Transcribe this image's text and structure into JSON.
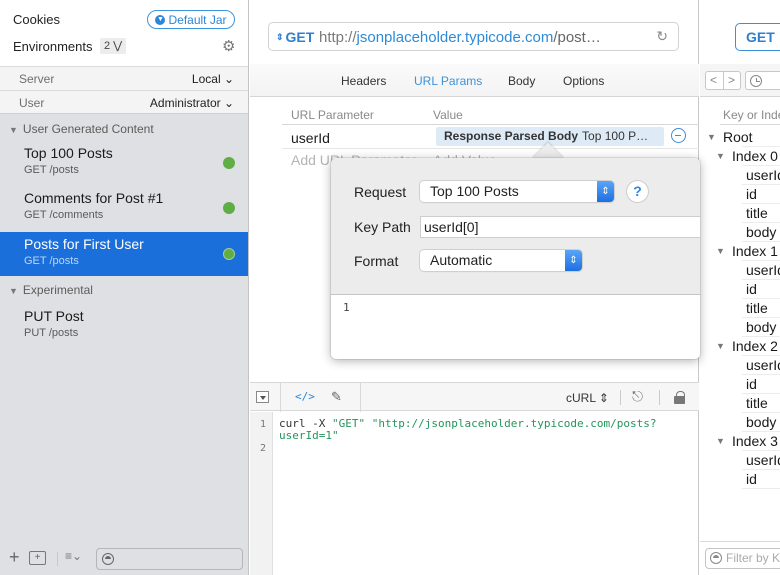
{
  "sidebar": {
    "cookies_label": "Cookies",
    "cookie_jar": "Default Jar",
    "environments_label": "Environments",
    "environments_count": "2",
    "env_vars": [
      {
        "key": "Server",
        "value": "Local"
      },
      {
        "key": "User",
        "value": "Administrator"
      }
    ],
    "groups": [
      {
        "name": "User Generated Content",
        "requests": [
          {
            "name": "Top 100 Posts",
            "sub": "GET /posts",
            "status": "success"
          },
          {
            "name": "Comments for Post #1",
            "sub": "GET /comments",
            "status": "success"
          },
          {
            "name": "Posts for First User",
            "sub": "GET /posts",
            "status": "success",
            "selected": true
          }
        ]
      },
      {
        "name": "Experimental",
        "requests": [
          {
            "name": "PUT Post",
            "sub": "PUT /posts"
          }
        ]
      }
    ],
    "filter_placeholder": ""
  },
  "request": {
    "method": "GET",
    "url_scheme": "http://",
    "url_host": "jsonplaceholder.typicode.com",
    "url_path": "/post…",
    "tabs": [
      "Headers",
      "URL Params",
      "Body",
      "Options"
    ],
    "active_tab": "URL Params",
    "params_header": {
      "name": "URL Parameter",
      "value": "Value"
    },
    "params": [
      {
        "name": "userId",
        "value_type": "Response Parsed Body",
        "value_ref": "Top 100 P…"
      }
    ],
    "add_param_placeholder": "Add URL Parameter",
    "add_value_placeholder": "Add Value"
  },
  "popover": {
    "request_label": "Request",
    "request_value": "Top 100 Posts",
    "help": "?",
    "keypath_label": "Key Path",
    "keypath_value": "userId[0]",
    "format_label": "Format",
    "format_value": "Automatic",
    "result_line": "1"
  },
  "code": {
    "format": "cURL",
    "lines": [
      {
        "num": "1",
        "prefix": "curl -X ",
        "method": "\"GET\"",
        "url": "\"http://jsonplaceholder.typicode.com/posts?",
        "cont": "userId=1\""
      },
      {
        "num": "2"
      }
    ]
  },
  "response": {
    "method": "GET",
    "tree_header": "Key or Index",
    "tree": [
      {
        "level": 0,
        "label": "Root",
        "expand": true
      },
      {
        "level": 1,
        "label": "Index 0",
        "expand": true
      },
      {
        "level": 2,
        "label": "userId"
      },
      {
        "level": 2,
        "label": "id"
      },
      {
        "level": 2,
        "label": "title"
      },
      {
        "level": 2,
        "label": "body"
      },
      {
        "level": 1,
        "label": "Index 1",
        "expand": true
      },
      {
        "level": 2,
        "label": "userId"
      },
      {
        "level": 2,
        "label": "id"
      },
      {
        "level": 2,
        "label": "title"
      },
      {
        "level": 2,
        "label": "body"
      },
      {
        "level": 1,
        "label": "Index 2",
        "expand": true
      },
      {
        "level": 2,
        "label": "userId"
      },
      {
        "level": 2,
        "label": "id"
      },
      {
        "level": 2,
        "label": "title"
      },
      {
        "level": 2,
        "label": "body"
      },
      {
        "level": 1,
        "label": "Index 3",
        "expand": true
      },
      {
        "level": 2,
        "label": "userId"
      },
      {
        "level": 2,
        "label": "id"
      }
    ],
    "filter_placeholder": "Filter by Key"
  },
  "colors": {
    "accent": "#2f86d6",
    "selection": "#1a6fdb",
    "status_ok": "#5fae45",
    "code_string": "#23955c"
  }
}
